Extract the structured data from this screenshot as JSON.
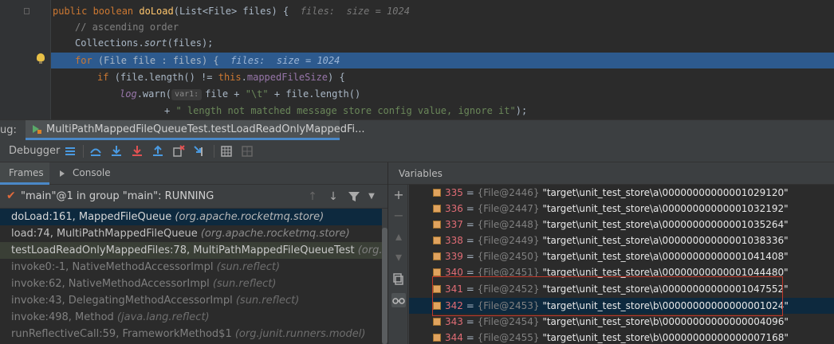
{
  "editor": {
    "lines": [
      {
        "kind": "sig",
        "t1": "public ",
        "t2": "boolean ",
        "fn": "doLoad",
        "rest": "(List<File> files) {  ",
        "inline": "files:  size = 1024"
      },
      {
        "kind": "comment",
        "text": "// ascending order"
      },
      {
        "kind": "sort",
        "t1": "Collections.",
        "fn": "sort",
        "rest": "(files);"
      },
      {
        "kind": "for",
        "kw": "for ",
        "rest": "(File file : files) {  ",
        "inline": "files:  size = 1024"
      },
      {
        "kind": "if",
        "kw": "if ",
        "a": "(file.length() != ",
        "this": "this",
        "dot": ".",
        "field": "mappedFileSize",
        "tail": ") {"
      },
      {
        "kind": "log",
        "obj": "log",
        "call": ".warn(",
        "hint": "var1:",
        "a": "file + ",
        "s": "\"\\t\"",
        "b": " + file.length()"
      },
      {
        "kind": "concat",
        "plus": "+ ",
        "s": "\" length not matched message store config value, ignore it\"",
        "tail": ");"
      }
    ]
  },
  "debug_tab": {
    "label": "ug:",
    "session": "MultiPathMappedFileQueueTest.testLoadReadOnlyMappedFi..."
  },
  "toolbar": {
    "title": "Debugger",
    "icons": [
      "show-execution-point-icon",
      "step-over-icon",
      "step-into-icon",
      "force-step-into-icon",
      "step-out-icon",
      "drop-frame-icon",
      "run-to-cursor-icon",
      "evaluate-expression-icon",
      "trace-icon"
    ]
  },
  "frames_panel": {
    "tabs": [
      "Frames",
      "Console"
    ],
    "thread": "\"main\"@1 in group \"main\": RUNNING",
    "frames": [
      {
        "method": "doLoad:161, MappedFileQueue ",
        "pkg": "(org.apache.rocketmq.store)"
      },
      {
        "method": "load:74, MultiPathMappedFileQueue ",
        "pkg": "(org.apache.rocketmq.store)"
      },
      {
        "method": "testLoadReadOnlyMappedFiles:78, MultiPathMappedFileQueueTest ",
        "pkg": "(org.apache.r"
      },
      {
        "method": "invoke0:-1, NativeMethodAccessorImpl ",
        "pkg": "(sun.reflect)"
      },
      {
        "method": "invoke:62, NativeMethodAccessorImpl ",
        "pkg": "(sun.reflect)"
      },
      {
        "method": "invoke:43, DelegatingMethodAccessorImpl ",
        "pkg": "(sun.reflect)"
      },
      {
        "method": "invoke:498, Method ",
        "pkg": "(java.lang.reflect)"
      },
      {
        "method": "runReflectiveCall:59, FrameworkMethod$1 ",
        "pkg": "(org.junit.runners.model)"
      }
    ]
  },
  "variables_panel": {
    "title": "Variables",
    "items": [
      {
        "idx": "335",
        "obj": "{File@2446}",
        "val": "\"target\\unit_test_store\\a\\00000000000001029120\""
      },
      {
        "idx": "336",
        "obj": "{File@2447}",
        "val": "\"target\\unit_test_store\\a\\00000000000001032192\""
      },
      {
        "idx": "337",
        "obj": "{File@2448}",
        "val": "\"target\\unit_test_store\\a\\00000000000001035264\""
      },
      {
        "idx": "338",
        "obj": "{File@2449}",
        "val": "\"target\\unit_test_store\\a\\00000000000001038336\""
      },
      {
        "idx": "339",
        "obj": "{File@2450}",
        "val": "\"target\\unit_test_store\\a\\00000000000001041408\""
      },
      {
        "idx": "340",
        "obj": "{File@2451}",
        "val": "\"target\\unit_test_store\\a\\00000000000001044480\""
      },
      {
        "idx": "341",
        "obj": "{File@2452}",
        "val": "\"target\\unit_test_store\\a\\00000000000001047552\""
      },
      {
        "idx": "342",
        "obj": "{File@2453}",
        "val": "\"target\\unit_test_store\\b\\00000000000000001024\""
      },
      {
        "idx": "343",
        "obj": "{File@2454}",
        "val": "\"target\\unit_test_store\\b\\00000000000000004096\""
      },
      {
        "idx": "344",
        "obj": "{File@2455}",
        "val": "\"target\\unit_test_store\\b\\00000000000000007168\""
      }
    ]
  },
  "colors": {
    "accent": "#4a88c7",
    "selection": "#0d293e",
    "execution_line": "#2d5a8e",
    "annotation_box": "#c0392b"
  }
}
